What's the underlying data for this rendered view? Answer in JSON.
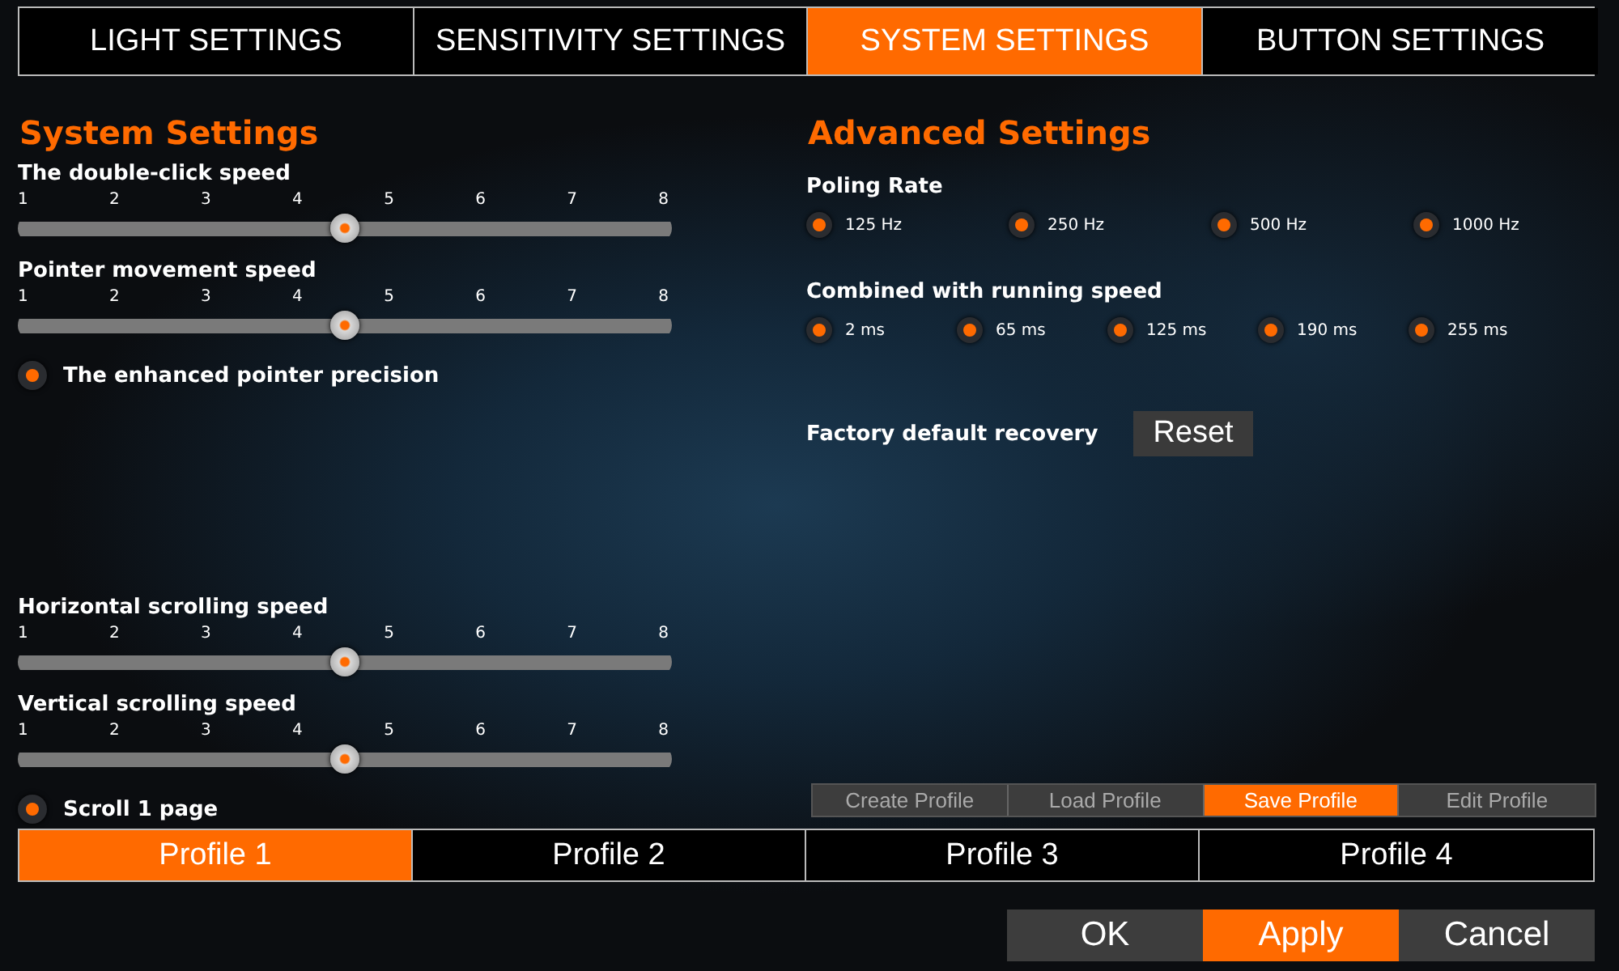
{
  "tabs": [
    {
      "label": "LIGHT SETTINGS",
      "selected": false
    },
    {
      "label": "SENSITIVITY SETTINGS",
      "selected": false
    },
    {
      "label": "SYSTEM SETTINGS",
      "selected": true
    },
    {
      "label": "BUTTON SETTINGS",
      "selected": false
    }
  ],
  "system_settings": {
    "title": "System Settings",
    "groups": [
      [
        {
          "kind": "slider",
          "label": "The double-click speed",
          "ticks": [
            "1",
            "2",
            "3",
            "4",
            "5",
            "6",
            "7",
            "8"
          ],
          "level": 0.5
        },
        {
          "kind": "slider",
          "label": "Pointer movement speed",
          "ticks": [
            "1",
            "2",
            "3",
            "4",
            "5",
            "6",
            "7",
            "8"
          ],
          "level": 0.5
        },
        {
          "kind": "toggle",
          "label": "The enhanced pointer precision",
          "on": true
        }
      ],
      [
        {
          "kind": "slider",
          "label": "Horizontal scrolling speed",
          "ticks": [
            "1",
            "2",
            "3",
            "4",
            "5",
            "6",
            "7",
            "8"
          ],
          "level": 0.5
        },
        {
          "kind": "slider",
          "label": "Vertical scrolling speed",
          "ticks": [
            "1",
            "2",
            "3",
            "4",
            "5",
            "6",
            "7",
            "8"
          ],
          "level": 0.5
        },
        {
          "kind": "toggle",
          "label": "Scroll 1 page",
          "on": true
        }
      ]
    ]
  },
  "advanced_settings": {
    "title": "Advanced Settings",
    "polling_rate": {
      "label": "Poling Rate",
      "options": [
        {
          "label": "125 Hz",
          "selected": true
        },
        {
          "label": "250 Hz",
          "selected": true
        },
        {
          "label": "500 Hz",
          "selected": true
        },
        {
          "label": "1000 Hz",
          "selected": true
        }
      ]
    },
    "running_speed": {
      "label": "Combined with running speed",
      "options": [
        {
          "label": "2 ms",
          "selected": true
        },
        {
          "label": "65 ms",
          "selected": true
        },
        {
          "label": "125 ms",
          "selected": true
        },
        {
          "label": "190 ms",
          "selected": true
        },
        {
          "label": "255 ms",
          "selected": true
        }
      ]
    },
    "factory_reset": {
      "label": "Factory default recovery",
      "button": "Reset"
    }
  },
  "profile_actions": [
    {
      "label": "Create Profile",
      "selected": false
    },
    {
      "label": "Load Profile",
      "selected": false
    },
    {
      "label": "Save Profile",
      "selected": true
    },
    {
      "label": "Edit Profile",
      "selected": false
    }
  ],
  "profiles": [
    {
      "label": "Profile 1",
      "selected": true
    },
    {
      "label": "Profile 2",
      "selected": false
    },
    {
      "label": "Profile 3",
      "selected": false
    },
    {
      "label": "Profile 4",
      "selected": false
    }
  ],
  "buttons": [
    {
      "label": "OK",
      "primary": false
    },
    {
      "label": "Apply",
      "primary": true
    },
    {
      "label": "Cancel",
      "primary": false
    }
  ]
}
